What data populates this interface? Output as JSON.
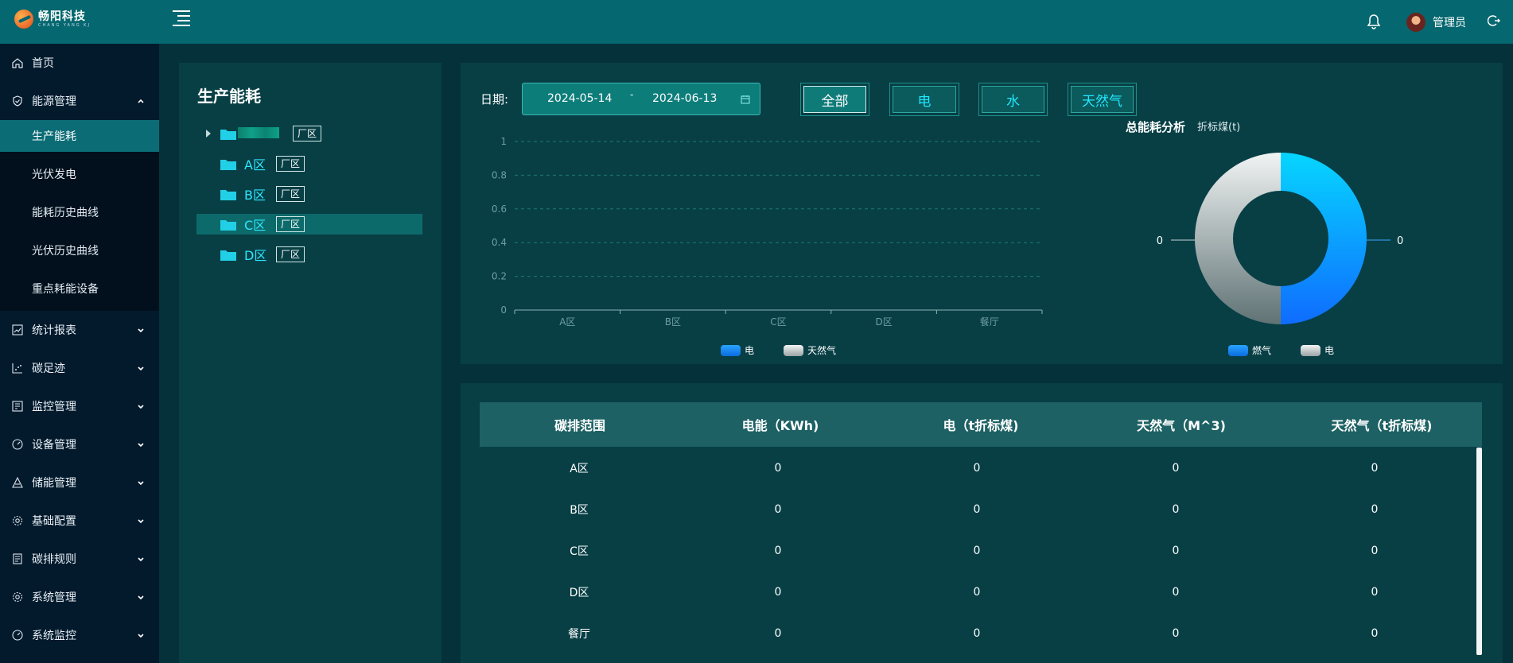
{
  "header": {
    "logo_text": "畅阳科技",
    "logo_subtext": "CHANG YANG KJ",
    "user_name": "管理员"
  },
  "sidebar": {
    "items": [
      {
        "label": "首页",
        "icon": "home-icon"
      },
      {
        "label": "能源管理",
        "icon": "shield-icon",
        "expanded": true
      },
      {
        "label": "统计报表",
        "icon": "line-chart-icon"
      },
      {
        "label": "碳足迹",
        "icon": "scatter-icon"
      },
      {
        "label": "监控管理",
        "icon": "monitor-icon"
      },
      {
        "label": "设备管理",
        "icon": "gauge-icon"
      },
      {
        "label": "储能管理",
        "icon": "triangle-icon"
      },
      {
        "label": "基础配置",
        "icon": "gear-icon"
      },
      {
        "label": "碳排规则",
        "icon": "document-icon"
      },
      {
        "label": "系统管理",
        "icon": "gear-icon"
      },
      {
        "label": "系统监控",
        "icon": "gauge-icon"
      }
    ],
    "submenu": [
      {
        "label": "生产能耗",
        "active": true
      },
      {
        "label": "光伏发电"
      },
      {
        "label": "能耗历史曲线"
      },
      {
        "label": "光伏历史曲线"
      },
      {
        "label": "重点耗能设备"
      }
    ]
  },
  "tree": {
    "title": "生产能耗",
    "tag": "厂区",
    "nodes": [
      {
        "label": ""
      },
      {
        "label": "A区"
      },
      {
        "label": "B区"
      },
      {
        "label": "C区",
        "selected": true
      },
      {
        "label": "D区"
      }
    ]
  },
  "filters": {
    "date_label": "日期:",
    "start_date": "2024-05-14",
    "separator": "-",
    "end_date": "2024-06-13",
    "buttons": [
      "全部",
      "电",
      "水",
      "天然气"
    ],
    "active": "全部"
  },
  "donut": {
    "title": "总能耗分析",
    "unit": "折标煤(t)",
    "left_value": "0",
    "right_value": "0",
    "legend": [
      "燃气",
      "电"
    ]
  },
  "chart_data": {
    "type": "bar",
    "categories": [
      "A区",
      "B区",
      "C区",
      "D区",
      "餐厅"
    ],
    "series": [
      {
        "name": "电",
        "values": [
          0,
          0,
          0,
          0,
          0
        ],
        "color": "#1a8cff"
      },
      {
        "name": "天然气",
        "values": [
          0,
          0,
          0,
          0,
          0
        ],
        "color": "#d9dcdc"
      }
    ],
    "yticks": [
      "0",
      "0.2",
      "0.4",
      "0.6",
      "0.8",
      "1"
    ],
    "ylim": [
      0,
      1
    ],
    "grid": true,
    "legend_position": "bottom-center"
  },
  "table": {
    "columns": [
      "碳排范围",
      "电能（KWh)",
      "电（t折标煤)",
      "天然气（M^3)",
      "天然气（t折标煤)"
    ],
    "rows": [
      [
        "A区",
        "0",
        "0",
        "0",
        "0"
      ],
      [
        "B区",
        "0",
        "0",
        "0",
        "0"
      ],
      [
        "C区",
        "0",
        "0",
        "0",
        "0"
      ],
      [
        "D区",
        "0",
        "0",
        "0",
        "0"
      ],
      [
        "餐厅",
        "0",
        "0",
        "0",
        "0"
      ]
    ]
  },
  "colors": {
    "topbar": "#05676f",
    "sidebar": "#031a2d",
    "panel": "#073f45",
    "accent": "#21e8ff",
    "active_nav": "#0b6c76"
  }
}
